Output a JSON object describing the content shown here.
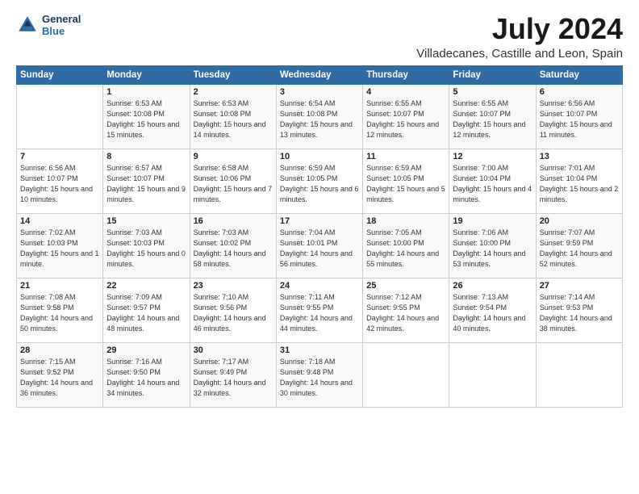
{
  "logo": {
    "line1": "General",
    "line2": "Blue"
  },
  "title": "July 2024",
  "location": "Villadecanes, Castille and Leon, Spain",
  "days_header": [
    "Sunday",
    "Monday",
    "Tuesday",
    "Wednesday",
    "Thursday",
    "Friday",
    "Saturday"
  ],
  "weeks": [
    [
      {
        "day": "",
        "sunrise": "",
        "sunset": "",
        "daylight": ""
      },
      {
        "day": "1",
        "sunrise": "Sunrise: 6:53 AM",
        "sunset": "Sunset: 10:08 PM",
        "daylight": "Daylight: 15 hours and 15 minutes."
      },
      {
        "day": "2",
        "sunrise": "Sunrise: 6:53 AM",
        "sunset": "Sunset: 10:08 PM",
        "daylight": "Daylight: 15 hours and 14 minutes."
      },
      {
        "day": "3",
        "sunrise": "Sunrise: 6:54 AM",
        "sunset": "Sunset: 10:08 PM",
        "daylight": "Daylight: 15 hours and 13 minutes."
      },
      {
        "day": "4",
        "sunrise": "Sunrise: 6:55 AM",
        "sunset": "Sunset: 10:07 PM",
        "daylight": "Daylight: 15 hours and 12 minutes."
      },
      {
        "day": "5",
        "sunrise": "Sunrise: 6:55 AM",
        "sunset": "Sunset: 10:07 PM",
        "daylight": "Daylight: 15 hours and 12 minutes."
      },
      {
        "day": "6",
        "sunrise": "Sunrise: 6:56 AM",
        "sunset": "Sunset: 10:07 PM",
        "daylight": "Daylight: 15 hours and 11 minutes."
      }
    ],
    [
      {
        "day": "7",
        "sunrise": "Sunrise: 6:56 AM",
        "sunset": "Sunset: 10:07 PM",
        "daylight": "Daylight: 15 hours and 10 minutes."
      },
      {
        "day": "8",
        "sunrise": "Sunrise: 6:57 AM",
        "sunset": "Sunset: 10:07 PM",
        "daylight": "Daylight: 15 hours and 9 minutes."
      },
      {
        "day": "9",
        "sunrise": "Sunrise: 6:58 AM",
        "sunset": "Sunset: 10:06 PM",
        "daylight": "Daylight: 15 hours and 7 minutes."
      },
      {
        "day": "10",
        "sunrise": "Sunrise: 6:59 AM",
        "sunset": "Sunset: 10:05 PM",
        "daylight": "Daylight: 15 hours and 6 minutes."
      },
      {
        "day": "11",
        "sunrise": "Sunrise: 6:59 AM",
        "sunset": "Sunset: 10:05 PM",
        "daylight": "Daylight: 15 hours and 5 minutes."
      },
      {
        "day": "12",
        "sunrise": "Sunrise: 7:00 AM",
        "sunset": "Sunset: 10:04 PM",
        "daylight": "Daylight: 15 hours and 4 minutes."
      },
      {
        "day": "13",
        "sunrise": "Sunrise: 7:01 AM",
        "sunset": "Sunset: 10:04 PM",
        "daylight": "Daylight: 15 hours and 2 minutes."
      }
    ],
    [
      {
        "day": "14",
        "sunrise": "Sunrise: 7:02 AM",
        "sunset": "Sunset: 10:03 PM",
        "daylight": "Daylight: 15 hours and 1 minute."
      },
      {
        "day": "15",
        "sunrise": "Sunrise: 7:03 AM",
        "sunset": "Sunset: 10:03 PM",
        "daylight": "Daylight: 15 hours and 0 minutes."
      },
      {
        "day": "16",
        "sunrise": "Sunrise: 7:03 AM",
        "sunset": "Sunset: 10:02 PM",
        "daylight": "Daylight: 14 hours and 58 minutes."
      },
      {
        "day": "17",
        "sunrise": "Sunrise: 7:04 AM",
        "sunset": "Sunset: 10:01 PM",
        "daylight": "Daylight: 14 hours and 56 minutes."
      },
      {
        "day": "18",
        "sunrise": "Sunrise: 7:05 AM",
        "sunset": "Sunset: 10:00 PM",
        "daylight": "Daylight: 14 hours and 55 minutes."
      },
      {
        "day": "19",
        "sunrise": "Sunrise: 7:06 AM",
        "sunset": "Sunset: 10:00 PM",
        "daylight": "Daylight: 14 hours and 53 minutes."
      },
      {
        "day": "20",
        "sunrise": "Sunrise: 7:07 AM",
        "sunset": "Sunset: 9:59 PM",
        "daylight": "Daylight: 14 hours and 52 minutes."
      }
    ],
    [
      {
        "day": "21",
        "sunrise": "Sunrise: 7:08 AM",
        "sunset": "Sunset: 9:58 PM",
        "daylight": "Daylight: 14 hours and 50 minutes."
      },
      {
        "day": "22",
        "sunrise": "Sunrise: 7:09 AM",
        "sunset": "Sunset: 9:57 PM",
        "daylight": "Daylight: 14 hours and 48 minutes."
      },
      {
        "day": "23",
        "sunrise": "Sunrise: 7:10 AM",
        "sunset": "Sunset: 9:56 PM",
        "daylight": "Daylight: 14 hours and 46 minutes."
      },
      {
        "day": "24",
        "sunrise": "Sunrise: 7:11 AM",
        "sunset": "Sunset: 9:55 PM",
        "daylight": "Daylight: 14 hours and 44 minutes."
      },
      {
        "day": "25",
        "sunrise": "Sunrise: 7:12 AM",
        "sunset": "Sunset: 9:55 PM",
        "daylight": "Daylight: 14 hours and 42 minutes."
      },
      {
        "day": "26",
        "sunrise": "Sunrise: 7:13 AM",
        "sunset": "Sunset: 9:54 PM",
        "daylight": "Daylight: 14 hours and 40 minutes."
      },
      {
        "day": "27",
        "sunrise": "Sunrise: 7:14 AM",
        "sunset": "Sunset: 9:53 PM",
        "daylight": "Daylight: 14 hours and 38 minutes."
      }
    ],
    [
      {
        "day": "28",
        "sunrise": "Sunrise: 7:15 AM",
        "sunset": "Sunset: 9:52 PM",
        "daylight": "Daylight: 14 hours and 36 minutes."
      },
      {
        "day": "29",
        "sunrise": "Sunrise: 7:16 AM",
        "sunset": "Sunset: 9:50 PM",
        "daylight": "Daylight: 14 hours and 34 minutes."
      },
      {
        "day": "30",
        "sunrise": "Sunrise: 7:17 AM",
        "sunset": "Sunset: 9:49 PM",
        "daylight": "Daylight: 14 hours and 32 minutes."
      },
      {
        "day": "31",
        "sunrise": "Sunrise: 7:18 AM",
        "sunset": "Sunset: 9:48 PM",
        "daylight": "Daylight: 14 hours and 30 minutes."
      },
      {
        "day": "",
        "sunrise": "",
        "sunset": "",
        "daylight": ""
      },
      {
        "day": "",
        "sunrise": "",
        "sunset": "",
        "daylight": ""
      },
      {
        "day": "",
        "sunrise": "",
        "sunset": "",
        "daylight": ""
      }
    ]
  ]
}
